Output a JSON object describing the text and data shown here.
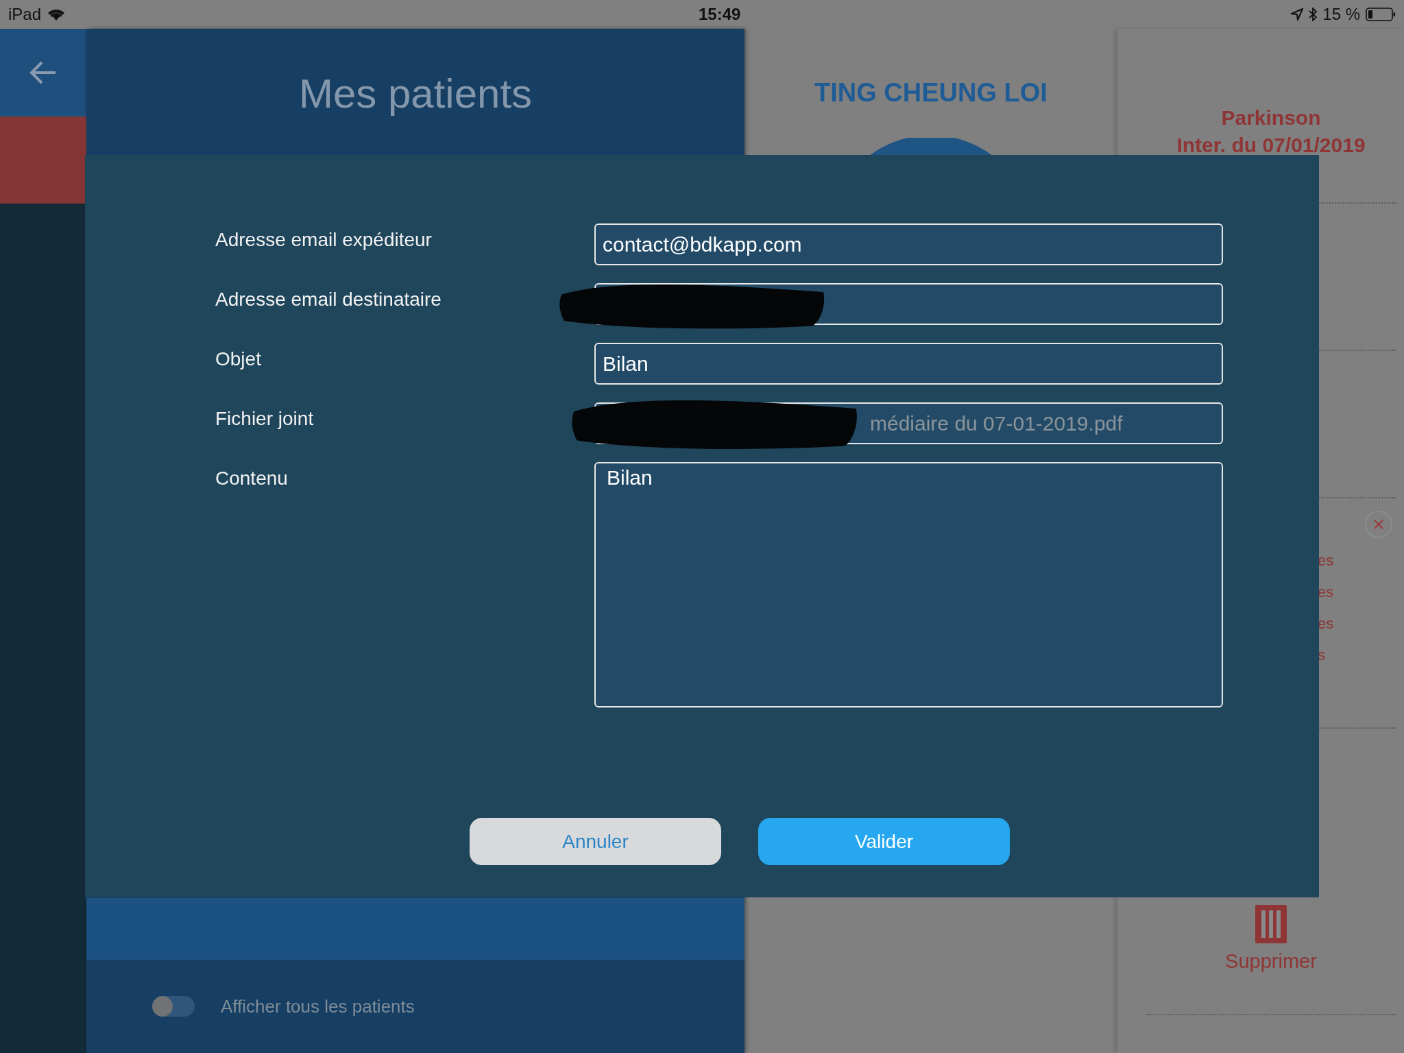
{
  "status_bar": {
    "device": "iPad",
    "time": "15:49",
    "battery": "15 %"
  },
  "patients_panel": {
    "title": "Mes patients",
    "toggle": {
      "label": "Afficher tous les patients",
      "on": false
    }
  },
  "patient_detail": {
    "name": "TING CHEUNG LOI"
  },
  "summary": {
    "title": "Parkinson",
    "subtitle": "Inter. du 07/01/2019",
    "list_fragments": [
      "es",
      "es",
      "es",
      "s"
    ],
    "delete_label": "Supprimer"
  },
  "dialog": {
    "fields": [
      {
        "kind": "input",
        "label": "Adresse email expéditeur",
        "value": "contact@bdkapp.com"
      },
      {
        "kind": "input",
        "label": "Adresse email destinataire",
        "redacted": true
      },
      {
        "kind": "input",
        "label": "Objet",
        "value": "Bilan"
      },
      {
        "kind": "input",
        "label": "Fichier joint",
        "value": "médiaire du 07-01-2019.pdf",
        "redacted": true
      },
      {
        "kind": "textarea",
        "label": "Contenu",
        "value": "Bilan"
      }
    ],
    "buttons": [
      {
        "kind": "secondary",
        "label": "Annuler"
      },
      {
        "kind": "primary",
        "label": "Valider"
      }
    ]
  }
}
